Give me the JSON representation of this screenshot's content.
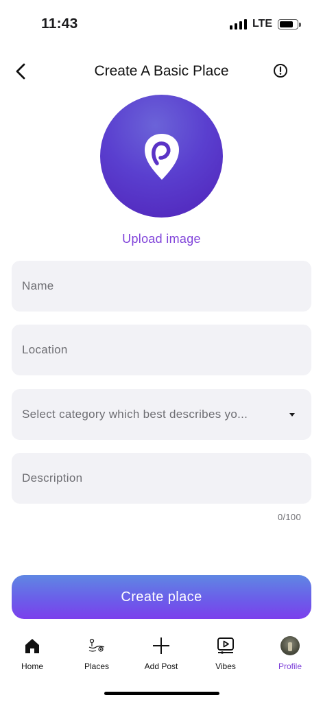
{
  "status_bar": {
    "time": "11:43",
    "network": "LTE"
  },
  "header": {
    "title": "Create A Basic Place",
    "back_icon": "chevron-left-icon",
    "info_icon": "info-circle-icon"
  },
  "avatar": {
    "logo_icon": "brand-logo-icon",
    "upload_label": "Upload image"
  },
  "form": {
    "name_placeholder": "Name",
    "location_placeholder": "Location",
    "category_placeholder": "Select category which best describes yo...",
    "description_placeholder": "Description",
    "description_counter": "0/100"
  },
  "cta": {
    "create_label": "Create place"
  },
  "tabbar": {
    "items": [
      {
        "label": "Home",
        "icon": "home-icon",
        "active": false
      },
      {
        "label": "Places",
        "icon": "places-icon",
        "active": false
      },
      {
        "label": "Add Post",
        "icon": "plus-icon",
        "active": false
      },
      {
        "label": "Vibes",
        "icon": "video-play-icon",
        "active": false
      },
      {
        "label": "Profile",
        "icon": "profile-avatar",
        "active": true
      }
    ]
  },
  "colors": {
    "accent": "#7e40d9",
    "field_bg": "#f2f2f6",
    "avatar_gradient": [
      "#6b63d8",
      "#5022b8"
    ],
    "button_gradient": [
      "#5f87e3",
      "#7b3fec"
    ]
  }
}
